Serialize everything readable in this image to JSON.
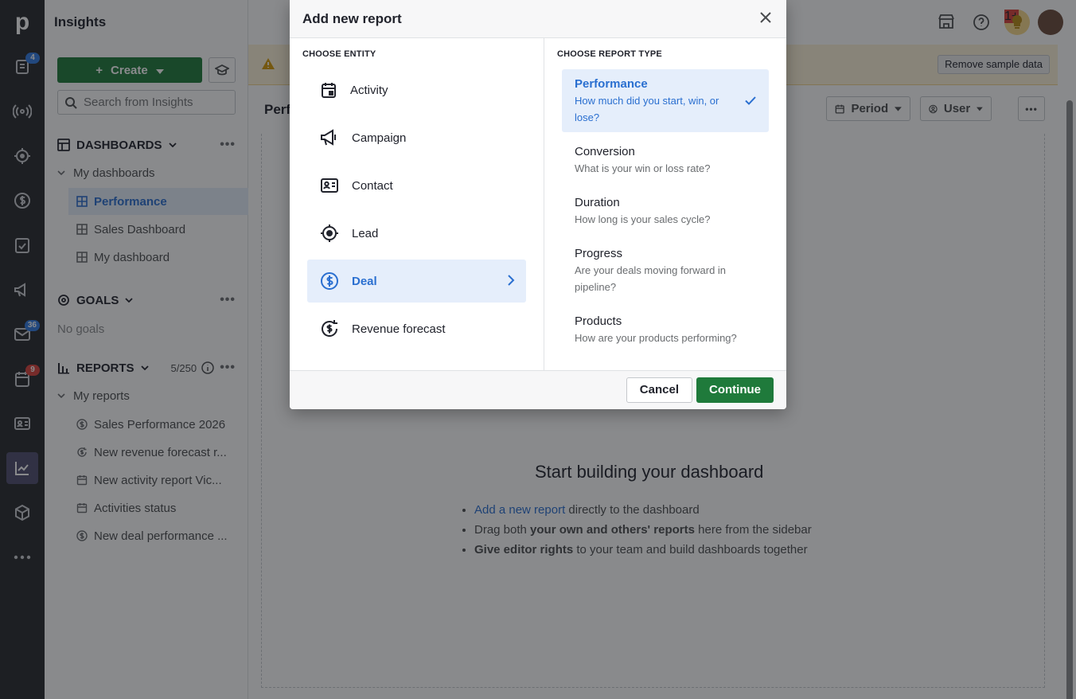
{
  "app": {
    "title": "Insights"
  },
  "nav": {
    "deals_badge": "4",
    "mail_badge": "36",
    "calendar_badge": "9",
    "notif_badge": "1+"
  },
  "sidebar": {
    "create_label": "Create",
    "search_placeholder": "Search from Insights",
    "dashboards": {
      "header": "DASHBOARDS",
      "group": "My dashboards",
      "items": [
        {
          "label": "Performance",
          "active": true
        },
        {
          "label": "Sales Dashboard"
        },
        {
          "label": "My dashboard"
        }
      ]
    },
    "goals": {
      "header": "GOALS",
      "empty": "No goals"
    },
    "reports": {
      "header": "REPORTS",
      "count": "5/250",
      "group": "My reports",
      "items": [
        {
          "label": "Sales Performance 2026",
          "icon": "dollar-icon"
        },
        {
          "label": "New revenue forecast r...",
          "icon": "forecast-icon"
        },
        {
          "label": "New activity report Vic...",
          "icon": "calendar-icon"
        },
        {
          "label": "Activities status",
          "icon": "calendar-icon"
        },
        {
          "label": "New deal performance ...",
          "icon": "dollar-icon"
        }
      ]
    }
  },
  "main": {
    "banner_button": "Remove sample data",
    "page_title_partial": "Perf",
    "period_label": "Period",
    "user_label": "User",
    "empty_title": "Start building your dashboard",
    "bullet1_link": "Add a new report",
    "bullet1_rest": " directly to the dashboard",
    "bullet2_pre": "Drag both ",
    "bullet2_bold": "your own and others' reports",
    "bullet2_rest": " here from the sidebar",
    "bullet3_bold": "Give editor rights",
    "bullet3_rest": " to your team and build dashboards together"
  },
  "modal": {
    "title": "Add new report",
    "entity_header": "CHOOSE ENTITY",
    "type_header": "CHOOSE REPORT TYPE",
    "entities": [
      {
        "label": "Activity",
        "icon": "calendar-icon"
      },
      {
        "label": "Campaign",
        "icon": "megaphone-icon"
      },
      {
        "label": "Contact",
        "icon": "contact-card-icon"
      },
      {
        "label": "Lead",
        "icon": "target-icon"
      },
      {
        "label": "Deal",
        "icon": "dollar-icon",
        "active": true
      },
      {
        "label": "Revenue forecast",
        "icon": "forecast-icon"
      }
    ],
    "report_types": [
      {
        "title": "Performance",
        "desc": "How much did you start, win, or lose?",
        "active": true
      },
      {
        "title": "Conversion",
        "desc": "What is your win or loss rate?"
      },
      {
        "title": "Duration",
        "desc": "How long is your sales cycle?"
      },
      {
        "title": "Progress",
        "desc": "Are your deals moving forward in pipeline?"
      },
      {
        "title": "Products",
        "desc": "How are your products performing?"
      }
    ],
    "cancel_label": "Cancel",
    "continue_label": "Continue"
  },
  "colors": {
    "brand_green": "#1f7a3b",
    "accent_blue": "#2a6fd0",
    "nav_bg": "#26292c"
  }
}
